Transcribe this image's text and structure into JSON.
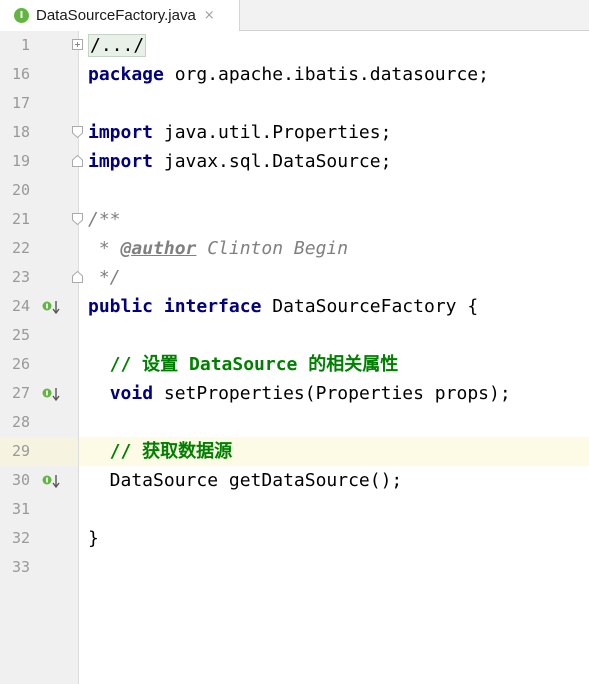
{
  "tab": {
    "icon_letter": "I",
    "filename": "DataSourceFactory.java",
    "close": "×"
  },
  "lines": {
    "l1": {
      "num": "1",
      "text": "/.../"
    },
    "l16": {
      "num": "16",
      "kw": "package",
      "rest": " org.apache.ibatis.datasource;"
    },
    "l17": {
      "num": "17"
    },
    "l18": {
      "num": "18",
      "kw": "import",
      "rest": " java.util.Properties;"
    },
    "l19": {
      "num": "19",
      "kw": "import",
      "rest": " javax.sql.DataSource;"
    },
    "l20": {
      "num": "20"
    },
    "l21": {
      "num": "21",
      "text": "/**"
    },
    "l22": {
      "num": "22",
      "prefix": " * ",
      "tag": "@author",
      "rest": " Clinton Begin"
    },
    "l23": {
      "num": "23",
      "text": " */"
    },
    "l24": {
      "num": "24",
      "kw1": "public",
      "kw2": "interface",
      "rest": " DataSourceFactory {"
    },
    "l25": {
      "num": "25"
    },
    "l26": {
      "num": "26",
      "text": "  // 设置 DataSource 的相关属性"
    },
    "l27": {
      "num": "27",
      "kw": "void",
      "rest": " setProperties(Properties props);"
    },
    "l28": {
      "num": "28"
    },
    "l29": {
      "num": "29",
      "text": "  // 获取数据源"
    },
    "l30": {
      "num": "30",
      "text": "  DataSource getDataSource();"
    },
    "l31": {
      "num": "31"
    },
    "l32": {
      "num": "32",
      "text": "}"
    },
    "l33": {
      "num": "33"
    }
  },
  "colors": {
    "keyword": "#000080",
    "comment": "#808080",
    "line_comment": "#008000",
    "current_line": "#fdfbe6",
    "implement_marker": "#62b543"
  }
}
